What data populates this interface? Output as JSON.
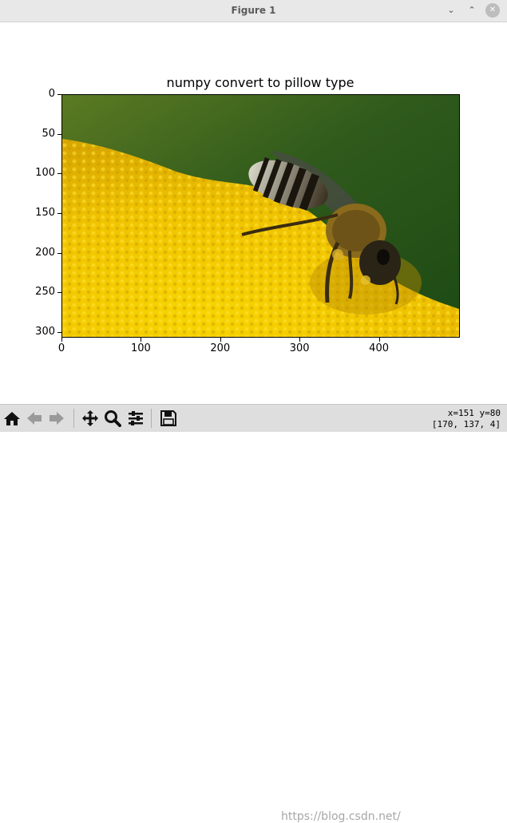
{
  "window": {
    "title": "Figure 1",
    "minimize_glyph": "⌄",
    "restore_glyph": "⌃",
    "close_glyph": "✕"
  },
  "figure": {
    "title": "numpy convert to pillow type",
    "x_ticks": [
      "0",
      "100",
      "200",
      "300",
      "400"
    ],
    "y_ticks": [
      "0",
      "50",
      "100",
      "150",
      "200",
      "250",
      "300"
    ],
    "image_description_colors": {
      "background_green": "#2f5a1c",
      "flower_yellow": "#f2c800",
      "bee_dark": "#2a2416"
    }
  },
  "toolbar": {
    "buttons": [
      {
        "name": "home-button",
        "icon": "home-icon"
      },
      {
        "name": "back-button",
        "icon": "arrow-left-icon"
      },
      {
        "name": "forward-button",
        "icon": "arrow-right-icon"
      },
      {
        "name": "pan-button",
        "icon": "move-icon"
      },
      {
        "name": "zoom-button",
        "icon": "magnifier-icon"
      },
      {
        "name": "configure-subplots-button",
        "icon": "sliders-icon"
      },
      {
        "name": "save-button",
        "icon": "floppy-icon"
      }
    ],
    "watermark": "https://blog.csdn.net/",
    "coord_line1": "x=151 y=80",
    "coord_line2": "[170, 137,  4]"
  }
}
